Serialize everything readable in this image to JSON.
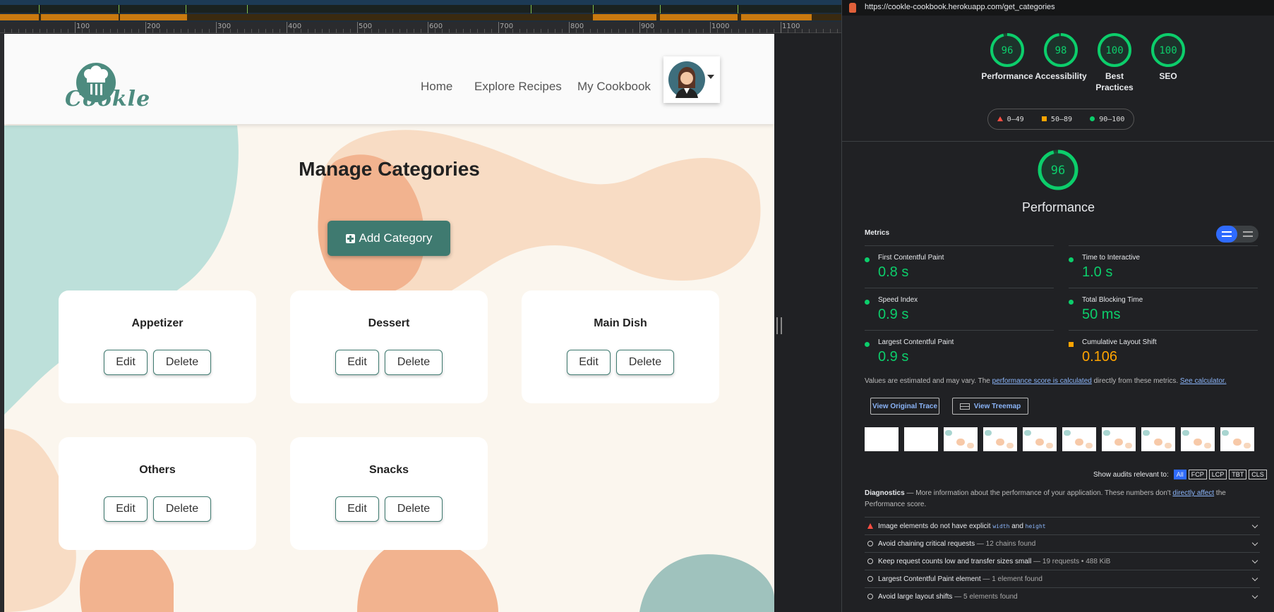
{
  "ruler": {
    "labels": [
      "100",
      "200",
      "300",
      "400",
      "500",
      "600",
      "700",
      "800",
      "900",
      "1000",
      "1100"
    ]
  },
  "site": {
    "logo_text": "Cookle",
    "nav": [
      "Home",
      "Explore Recipes",
      "My Cookbook"
    ],
    "title": "Manage Categories",
    "add_button": "Add Category",
    "edit_label": "Edit",
    "delete_label": "Delete",
    "categories": [
      "Appetizer",
      "Dessert",
      "Main Dish",
      "Others",
      "Snacks"
    ],
    "colors": {
      "primary": "#3f7a70",
      "teal_blob": "#a8d5d0",
      "peach_blob": "#f7c9a8",
      "page_bg": "#fbf6ee"
    }
  },
  "lighthouse": {
    "url": "https://cookle-cookbook.herokuapp.com/get_categories",
    "scores": [
      {
        "value": "96",
        "label": "Performance"
      },
      {
        "value": "98",
        "label": "Accessibility"
      },
      {
        "value": "100",
        "label": "Best Practices"
      },
      {
        "value": "100",
        "label": "SEO"
      }
    ],
    "legend": [
      "0–49",
      "50–89",
      "90–100"
    ],
    "main_score": "96",
    "main_title": "Performance",
    "metrics_heading": "Metrics",
    "metrics": [
      {
        "name": "First Contentful Paint",
        "value": "0.8 s",
        "status": "pass"
      },
      {
        "name": "Time to Interactive",
        "value": "1.0 s",
        "status": "pass"
      },
      {
        "name": "Speed Index",
        "value": "0.9 s",
        "status": "pass"
      },
      {
        "name": "Total Blocking Time",
        "value": "50 ms",
        "status": "pass"
      },
      {
        "name": "Largest Contentful Paint",
        "value": "0.9 s",
        "status": "pass"
      },
      {
        "name": "Cumulative Layout Shift",
        "value": "0.106",
        "status": "average"
      }
    ],
    "disclaimer": {
      "pre": "Values are estimated and may vary. The ",
      "link1": "performance score is calculated",
      "mid": " directly from these metrics. ",
      "link2": "See calculator."
    },
    "view_trace": "View Original Trace",
    "view_treemap": "View Treemap",
    "audits_filter": {
      "label": "Show audits relevant to:",
      "chips": [
        "All",
        "FCP",
        "LCP",
        "TBT",
        "CLS"
      ]
    },
    "diagnostics": {
      "heading": "Diagnostics",
      "pre": " — More information about the performance of your application. These numbers don't ",
      "link": "directly affect",
      "post": " the Performance score."
    },
    "audits": [
      {
        "title": "Image elements do not have explicit ",
        "code1": "width",
        "and": " and ",
        "code2": "height",
        "desc": "",
        "icon": "fail"
      },
      {
        "title": "Avoid chaining critical requests",
        "desc": " — 12 chains found",
        "icon": "info"
      },
      {
        "title": "Keep request counts low and transfer sizes small",
        "desc": " — 19 requests • 488 KiB",
        "icon": "info"
      },
      {
        "title": "Largest Contentful Paint element",
        "desc": " — 1 element found",
        "icon": "info"
      },
      {
        "title": "Avoid large layout shifts",
        "desc": " — 5 elements found",
        "icon": "info"
      }
    ],
    "colors": {
      "pass": "#0cce6b",
      "average": "#ffa400",
      "fail": "#ff4e42",
      "link": "#8ab4f8"
    }
  }
}
